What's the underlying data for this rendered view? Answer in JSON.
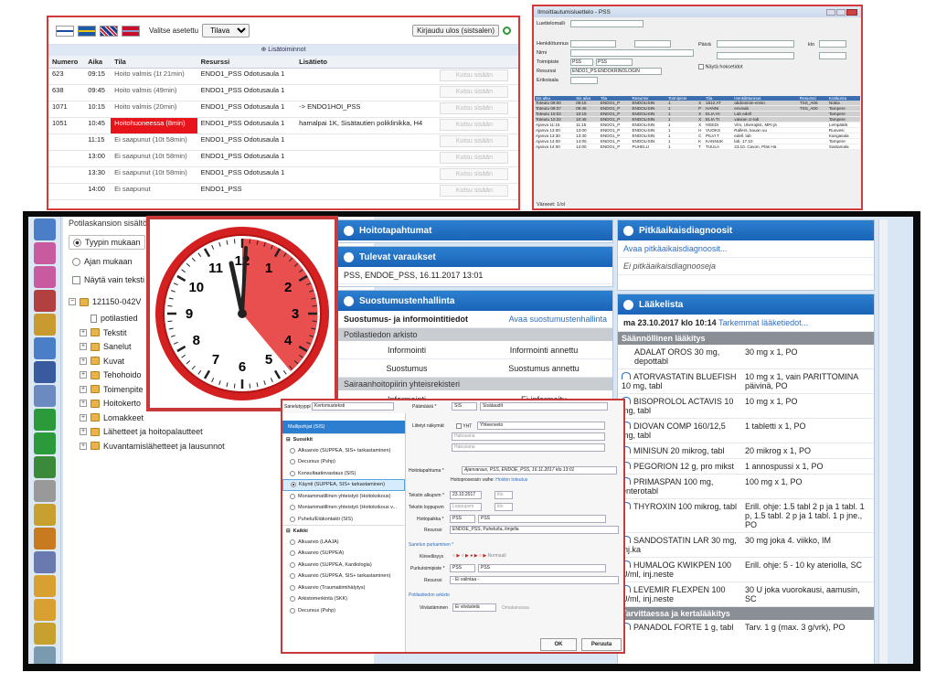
{
  "queue": {
    "settings_label": "Valitse asetettu",
    "settings_value": "Tilava",
    "logout": "Kirjaudu ulos (sistsalen)",
    "subhead": "⊕ Lisätoiminnot",
    "columns": [
      "Numero",
      "Aika",
      "Tila",
      "Resurssi",
      "Lisätieto"
    ],
    "rows": [
      {
        "num": "623",
        "time": "09:15",
        "status": "Hoito valmis (1t 21min)",
        "res": "ENDO1_PSS Odotusaula 1",
        "info": "",
        "red": false
      },
      {
        "num": "638",
        "time": "09:45",
        "status": "Hoito valmis (49min)",
        "res": "ENDO1_PSS Odotusaula 1",
        "info": "",
        "red": false
      },
      {
        "num": "1071",
        "time": "10:15",
        "status": "Hoito valmis (20min)",
        "res": "ENDO1_PSS Odotusaula 1",
        "info": "-> ENDO1HOI_PSS",
        "red": false
      },
      {
        "num": "1051",
        "time": "10:45",
        "status": "Hoitohuoneessa (8min)",
        "res": "ENDO1_PSS Odotusaula 1",
        "info": "hamalpai 1K, Sisätautien poliklinikka, H4",
        "red": true
      },
      {
        "num": "",
        "time": "11:15",
        "status": "Ei saapunut (10t 58min)",
        "res": "ENDO1_PSS Odotusaula 1",
        "info": "",
        "red": false
      },
      {
        "num": "",
        "time": "13:00",
        "status": "Ei saapunut (10t 58min)",
        "res": "ENDO1_PSS Odotusaula 1",
        "info": "",
        "red": false
      },
      {
        "num": "",
        "time": "13:30",
        "status": "Ei saapunut (10t 58min)",
        "res": "ENDO1_PSS Odotusaula 1",
        "info": "",
        "red": false
      },
      {
        "num": "",
        "time": "14:00",
        "status": "Ei saapunut",
        "res": "ENDO1_PSS",
        "info": "",
        "red": false
      }
    ],
    "call_label": "Kutsu sisään"
  },
  "list": {
    "title": "Ilmoittautumisluettelo - PSS",
    "labels": {
      "lomake": "Luettelomalli",
      "henk": "Henkilötunnus",
      "nimi": "Nimi",
      "toim": "Toimipiste",
      "res": "Resurssi",
      "erik": "Erikoisala",
      "paiva": "Päivä",
      "klo": "klo",
      "nayta": "Näytä hoksetidot",
      "toim_v": "PSS",
      "res_v": "ENDO1_PS ENDOKRINOLOGIN VASTAAN"
    },
    "cols": [
      "Sis alku",
      "Sis aika",
      "Tila",
      "Resurssi",
      "Toimipiste",
      "",
      "Tila",
      "Henkilötunnus",
      "Resurssi",
      "Kotikunta"
    ],
    "rows": [
      [
        "Toteutu 09:00",
        "09:15",
        "ENDO1_P",
        "ENDOLISIN",
        "1",
        "X",
        "1512 AT",
        "abdominin-ensin",
        "TSS_A06",
        "Nokia"
      ],
      [
        "Toteutu 09:37",
        "09:45",
        "ENDO1_P",
        "ENDOLISIN",
        "1",
        "P",
        "HANNI",
        "envivab",
        "TSS_A00",
        "Tampere"
      ],
      [
        "Toteutu 10:02",
        "10:15",
        "ENDO1_P",
        "ENDOLISIN",
        "1",
        "X",
        "ELIA HI",
        "Lab edell",
        "",
        "Tampere"
      ],
      [
        "Toteutu 10:22",
        "10:45",
        "ENDO1_P",
        "ENDOLISIN",
        "1",
        "X",
        "ELIA TI",
        "vaivian cr-lab",
        "",
        "Tampere"
      ],
      [
        "Ajanva 11:15",
        "11:15",
        "ENDO1_P",
        "ENDOLISIN",
        "1",
        "X",
        "HEEDI",
        "Vlm, Ulverajälc, MRI jä",
        "",
        "Lempäälä"
      ],
      [
        "Ajanva 13:00",
        "13:00",
        "ENDO1_P",
        "ENDOLISIN",
        "1",
        "H",
        "VUOKS",
        "Rallers, kauan uu",
        "",
        "Ruovesi"
      ],
      [
        "Ajanva 13:30",
        "13:30",
        "ENDO1_P",
        "ENDOLISIN",
        "1",
        "C",
        "PILVI T",
        "edell. lab",
        "",
        "Kangasala"
      ],
      [
        "Ajanva 14:00",
        "14:00",
        "ENDO1_P",
        "ENDOLISIN",
        "1",
        "K",
        "KANNUK",
        "lab. 17.10.",
        "",
        "Tampere"
      ],
      [
        "Ajanva 14:00",
        "14:00",
        "ENDO1_P",
        "PUHELU",
        "1",
        "T",
        "TUULA",
        "23.10. Cavon, Pläs Hä",
        "",
        "Sastamala"
      ]
    ],
    "footer": "Värxeet: 1/ol"
  },
  "tree": {
    "header": "Potilaskansion sisältö",
    "radio1": "Tyypin mukaan",
    "radio2": "Ajan mukaan",
    "check": "Näytä vain teksti",
    "root": "121150-042V",
    "items": [
      "potilastied",
      "Tekstit",
      "Sanelut",
      "Kuvat",
      "Tehohoido",
      "Toimenpite",
      "Hoitokerto",
      "Lomakkeet",
      "Lähetteet ja hoitopalautteet",
      "Kuvantamislähetteet ja lausunnot"
    ]
  },
  "left_icons": [
    "info",
    "info",
    "info",
    "gear",
    "tools",
    "search",
    "DG TMP",
    "chart",
    "plus",
    "plus",
    "REC",
    "KEIO",
    "pill",
    "pencil",
    "doc",
    "folder",
    "folder",
    "copy",
    "copy"
  ],
  "hoitopalvelut": {
    "title": "Hoitotapahtumat",
    "title2": "Tulevat varaukset",
    "varaus": "PSS, ENDOE_PSS, 16.11.2017 13:01",
    "title3": "Suostumustenhallinta",
    "sub1": "Suostumus- ja informointitiedot",
    "sub1_link": "Avaa suostumustenhallinta",
    "arkisto": "Potilastiedon arkisto",
    "r1a": "Informointi",
    "r1b": "Informointi annettu",
    "r2a": "Suostumus",
    "r2b": "Suostumus annettu",
    "rekisteri": "Sairaanhoitopiirin yhteisrekisteri",
    "r3a": "Informointi",
    "r3b": "Ei informoitu"
  },
  "diag": {
    "title": "Pitkäaikaisdiagnoosit",
    "link": "Avaa pitkäaikaisdiagnoosit...",
    "empty": "Ei pitkäaikaisdiagnooseja"
  },
  "meds": {
    "title": "Lääkelista",
    "date": "ma 23.10.2017 klo 10:14",
    "link": "Tarkemmat lääketiedot...",
    "group1": "Säännöllinen lääkitys",
    "group2": "Tarvittaessa ja kertalääkitys",
    "items": [
      {
        "name": "ADALAT OROS 30 mg, depottabl",
        "dose": "30 mg x 1, PO",
        "icon": false
      },
      {
        "name": "ATORVASTATIN BLUEFISH 10 mg, tabl",
        "dose": "10 mg x 1, vain PARITTOMINA päivinä, PO",
        "icon": true
      },
      {
        "name": "BISOPROLOL ACTAVIS 10 mg, tabl",
        "dose": "10 mg x 1, PO",
        "icon": true
      },
      {
        "name": "DIOVAN COMP 160/12,5 mg, tabl",
        "dose": "1 tabletti x 1, PO",
        "icon": true
      },
      {
        "name": "MINISUN 20 mikrog, tabl",
        "dose": "20 mikrog x 1, PO",
        "icon": true
      },
      {
        "name": "PEGORION 12 g, pro mikst",
        "dose": "1 annospussi x 1, PO",
        "icon": true
      },
      {
        "name": "PRIMASPAN 100 mg, enterotabl",
        "dose": "100 mg x 1, PO",
        "icon": true
      },
      {
        "name": "THYROXIN 100 mikrog, tabl",
        "dose": "Erill. ohje: 1.5 tabl 2 p ja 1 tabl. 1 p, 1.5 tabl. 2 p ja 1 tabl. 1 p jne., PO",
        "icon": true
      },
      {
        "name": "SANDOSTATIN LAR 30 mg, inj.ka",
        "dose": "30 mg joka 4. viikko, IM",
        "icon": true
      },
      {
        "name": "HUMALOG KWIKPEN 100 U/ml, inj.neste",
        "dose": "Erill. ohje: 5 - 10 ky ateriolla, SC",
        "icon": true
      },
      {
        "name": "LEVEMIR FLEXPEN 100 U/ml, inj.neste",
        "dose": "30 U joka vuorokausi, aamusin, SC",
        "icon": true
      }
    ],
    "prn": {
      "name": "PANADOL FORTE 1 g, tabl",
      "dose": "Tarv. 1 g (max. 3 g/vrk), PO"
    }
  },
  "clock": {
    "hours": [
      "12",
      "1",
      "2",
      "3",
      "4",
      "5",
      "6",
      "7",
      "8",
      "9",
      "10",
      "11"
    ]
  },
  "dialog": {
    "sanelutyyppi": "Sanelutyyppi",
    "sanelutyyppi_v": "Kertomusteksti",
    "palvelu": "Päämäärä *",
    "palvelu_v": "SIS",
    "palvelu_v2": "Sisätaudit",
    "mallipohjat": "Mallipohjat (SIS)",
    "suosikit": "Suosikit",
    "kaikki": "Kaikki",
    "fav": [
      "Alkuarvio (SUPPEA, SIS+ tarkastaminen)",
      "Decursus (Pshp)",
      "Konsultaatiovastaus (SIS)",
      "Käynti (SUPPEA, SIS+ tarkastaminen)",
      "Moniammatillinen yhteistyö (Hoitokokous)",
      "Moniammatillinen yhteistyö (Hoitokokous v...",
      "Puhelu/Etäkontakti (SIS)"
    ],
    "all": [
      "Alkuarvio (LAAJA)",
      "Alkuarvio (SUPPEA)",
      "Alkuarvio (SUPPEA, Kardiologia)",
      "Alkuarvio (SUPPEA, SIS+ tarkastaminen)",
      "Alkuarvio (Traumatiimihälytys)",
      "Arkistomerkintä (SKK)",
      "Decursus (Pshp)"
    ],
    "liitetyt": "Liitetyt näkymät",
    "yht": "YHT",
    "yht_v": "Yhteenveto",
    "hakusana": "Hakusana",
    "hoitotap": "Hoitotapahtuma *",
    "hoitotap_v": "Ajanvaraus, PSS, ENDOE_PSS, 16.11.2017 klo 13:01",
    "prosessi": "Hoitoprosessin vaihe:",
    "prosessi_v": "Hoidon toteutus",
    "alku": "Tekstin alkupvm *",
    "alku_v": "23.10.2017",
    "klo": "klo",
    "loppu": "Tekstin loppupvm",
    "loppu_v": "Loppupvm",
    "hoitopaikka": "Hoitopaikka *",
    "hp1": "PSS",
    "hp2": "PSS",
    "resurssi": "Resurssi",
    "resurssi_v": "ENDOE_PSS, Puhelu/ta, ilmjella",
    "sanelun": "Sanelun purkaminen *",
    "kiireellisyys": "Kiireellisyys",
    "normaali": "Normaali",
    "purkupiste": "Purkutoimipiste *",
    "pp1": "PSS",
    "pp2": "PSS",
    "resurssi2": "Resurssi",
    "resurssi2_v": "- Ei valintaa -",
    "arkisto": "Potilastiedon arkisto",
    "viivastys": "Viivästäminen",
    "viivastys_v": "Ei viivästetä",
    "omakanava": "Omakanavaa",
    "ok": "OK",
    "peruuta": "Peruuta"
  }
}
